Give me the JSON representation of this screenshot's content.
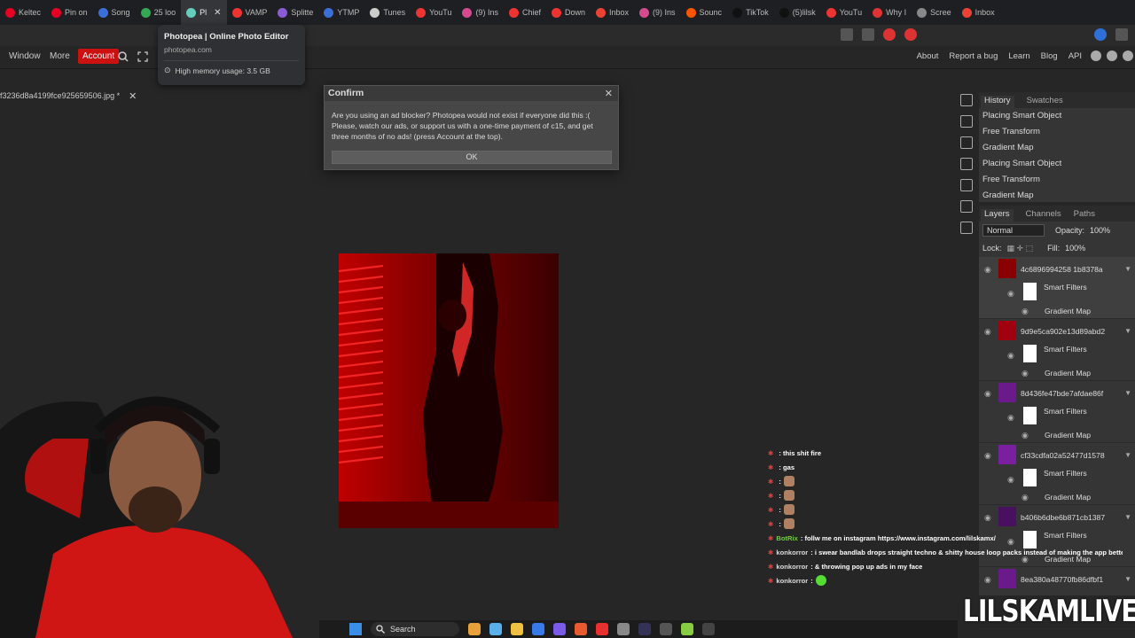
{
  "browser": {
    "tabs": [
      {
        "label": "Keltec",
        "color": "#e60023"
      },
      {
        "label": "Pin on",
        "color": "#e60023"
      },
      {
        "label": "Song",
        "color": "#3b6fd8"
      },
      {
        "label": "25 loo",
        "color": "#34a853"
      },
      {
        "label": "Pl",
        "color": "#6cb",
        "active": true
      },
      {
        "label": "VAMP",
        "color": "#e33"
      },
      {
        "label": "Splitte",
        "color": "#8a5ad8"
      },
      {
        "label": "YTMP",
        "color": "#3b6fd8"
      },
      {
        "label": "Tunes",
        "color": "#ccc"
      },
      {
        "label": "YouTu",
        "color": "#e33"
      },
      {
        "label": "(9) Ins",
        "color": "#d64b8f"
      },
      {
        "label": "Chief",
        "color": "#e33"
      },
      {
        "label": "Down",
        "color": "#e33"
      },
      {
        "label": "Inbox",
        "color": "#ea4335"
      },
      {
        "label": "(9) Ins",
        "color": "#d64b8f"
      },
      {
        "label": "Sounc",
        "color": "#f50"
      },
      {
        "label": "TikTok",
        "color": "#111"
      },
      {
        "label": "(5)lilsk",
        "color": "#111"
      },
      {
        "label": "YouTu",
        "color": "#e33"
      },
      {
        "label": "Why I",
        "color": "#d33"
      },
      {
        "label": "Scree",
        "color": "#888"
      },
      {
        "label": "Inbox",
        "color": "#ea4335"
      }
    ],
    "tooltip": {
      "title": "Photopea | Online Photo Editor",
      "url": "photopea.com",
      "memory": "High memory usage: 3.5 GB"
    }
  },
  "photopea": {
    "menu": {
      "window": "Window",
      "more": "More",
      "account": "Account"
    },
    "links": [
      "About",
      "Report a bug",
      "Learn",
      "Blog",
      "API"
    ],
    "document_tab": "f3236d8a4199fce925659506.jpg *",
    "dialog": {
      "title": "Confirm",
      "message": "Are you using an ad blocker? Photopea would not exist if everyone did this :( Please, watch our ads, or support us with a one-time payment of c15, and get three months of no ads! (press Account at the top).",
      "ok": "OK"
    },
    "history": {
      "tabs": [
        "History",
        "Swatches"
      ],
      "items": [
        "Placing Smart Object",
        "Free Transform",
        "Gradient Map",
        "Placing Smart Object",
        "Free Transform",
        "Gradient Map"
      ]
    },
    "layers_panel": {
      "tabs": [
        "Layers",
        "Channels",
        "Paths"
      ],
      "blend_mode": "Normal",
      "opacity_label": "Opacity:",
      "opacity": "100%",
      "lock_label": "Lock:",
      "fill_label": "Fill:",
      "fill": "100%",
      "layers": [
        {
          "name": "4c6896994258 1b8378a",
          "smart_filters": "Smart Filters",
          "filter": "Gradient Map",
          "thumb": "#8a0000"
        },
        {
          "name": "9d9e5ca902e13d89abd2",
          "smart_filters": "Smart Filters",
          "filter": "Gradient Map",
          "thumb": "#a00010"
        },
        {
          "name": "8d436fe47bde7afdae86f",
          "smart_filters": "Smart Filters",
          "filter": "Gradient Map",
          "thumb": "#6a1a8a"
        },
        {
          "name": "cf33cdfa02a52477d1578",
          "smart_filters": "Smart Filters",
          "filter": "Gradient Map",
          "thumb": "#7a1fa0"
        },
        {
          "name": "b406b6dbe6b871cb1387",
          "smart_filters": "Smart Filters",
          "filter": "Gradient Map",
          "thumb": "#4a1060"
        },
        {
          "name": "8ea380a48770fb86dfbf1",
          "smart_filters": "",
          "filter": "",
          "thumb": "#6a1a8a"
        }
      ]
    }
  },
  "chat": [
    {
      "user": "",
      "text": ": this shit fire",
      "emotes": 0
    },
    {
      "user": "",
      "text": ": gas",
      "emotes": 0
    },
    {
      "user": "",
      "text": ":",
      "emotes": 1
    },
    {
      "user": "",
      "text": ":",
      "emotes": 1
    },
    {
      "user": "",
      "text": ":",
      "emotes": 1
    },
    {
      "user": "",
      "text": ":",
      "emotes": 1
    },
    {
      "user": "BotRix",
      "text": ": follw me on instagram https://www.instagram.com/lilskamx/",
      "emotes": 0
    },
    {
      "user": "konkorror",
      "text": ": i swear bandlab drops straight techno & shitty house loop packs instead of making the app better",
      "emotes": 0
    },
    {
      "user": "konkorror",
      "text": ": & throwing pop up ads in my face",
      "emotes": 0
    },
    {
      "user": "konkorror",
      "text": ":",
      "emotes": 2
    }
  ],
  "watermark": "LILSKAMLIVE",
  "taskbar": {
    "search": "Search"
  }
}
